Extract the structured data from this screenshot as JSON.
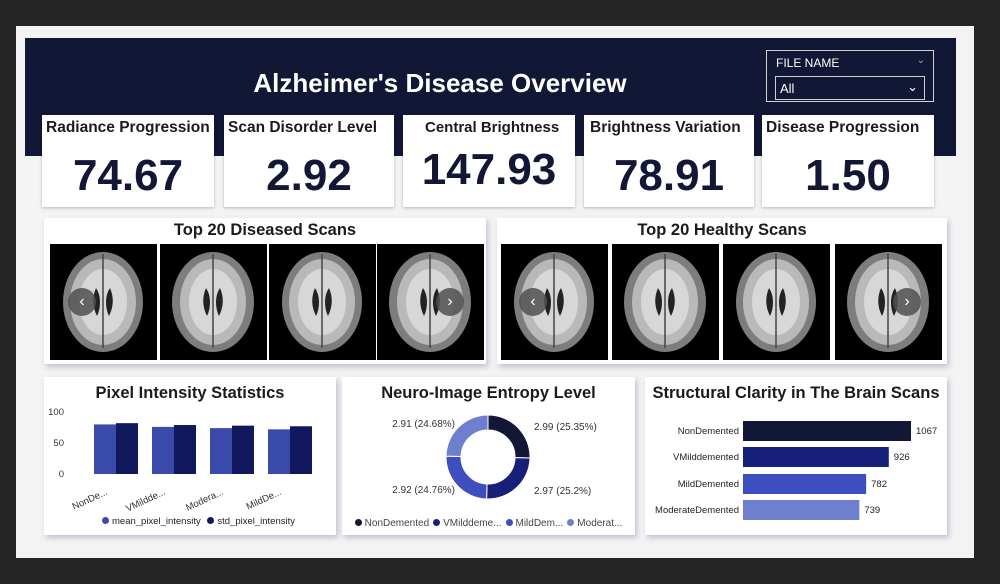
{
  "dashboard": {
    "title": "Alzheimer's Disease Overview",
    "filter": {
      "label": "FILE NAME",
      "value": "All"
    }
  },
  "kpis": [
    {
      "label": "Radiance Progression",
      "value": "74.67"
    },
    {
      "label": "Scan Disorder Level",
      "value": "2.92"
    },
    {
      "label": "Central Brightness",
      "value": "147.93"
    },
    {
      "label": "Brightness Variation",
      "value": "78.91"
    },
    {
      "label": "Disease Progression",
      "value": "1.50"
    }
  ],
  "carousels": {
    "diseased": {
      "title": "Top 20 Diseased Scans"
    },
    "healthy": {
      "title": "Top 20 Healthy Scans"
    }
  },
  "colors": {
    "navy": "#121735",
    "dark_blue": "#16207a",
    "mid_blue": "#3d4fbf",
    "light_blue": "#6f7fd0",
    "pixel_mean": "#3a4aaa",
    "pixel_std": "#11185e"
  },
  "chart_data": [
    {
      "type": "bar",
      "title": "Pixel Intensity Statistics",
      "categories": [
        "NonDe...",
        "VMildde...",
        "Modera...",
        "MildDe..."
      ],
      "series": [
        {
          "name": "mean_pixel_intensity",
          "values": [
            80,
            76,
            74,
            72
          ]
        },
        {
          "name": "std_pixel_intensity",
          "values": [
            82,
            79,
            78,
            77
          ]
        }
      ],
      "ylim": [
        0,
        100
      ],
      "yticks": [
        "100",
        "50",
        "0"
      ],
      "legend": "bottom"
    },
    {
      "type": "pie",
      "title": "Neuro-Image Entropy Level",
      "categories": [
        "NonDemented",
        "VMilddeme...",
        "MildDem...",
        "Moderat..."
      ],
      "values": [
        2.99,
        2.97,
        2.92,
        2.91
      ],
      "labels": [
        "2.99 (25.35%)",
        "2.97 (25.2%)",
        "2.92 (24.76%)",
        "2.91 (24.68%)"
      ],
      "legend": "bottom"
    },
    {
      "type": "bar",
      "title": "Structural Clarity in The Brain Scans",
      "categories": [
        "NonDemented",
        "VMilddemented",
        "MildDemented",
        "ModerateDemented"
      ],
      "values": [
        1067,
        926,
        782,
        739
      ],
      "value_labels": [
        "1067",
        "926",
        "782",
        "739"
      ],
      "orientation": "horizontal"
    }
  ]
}
